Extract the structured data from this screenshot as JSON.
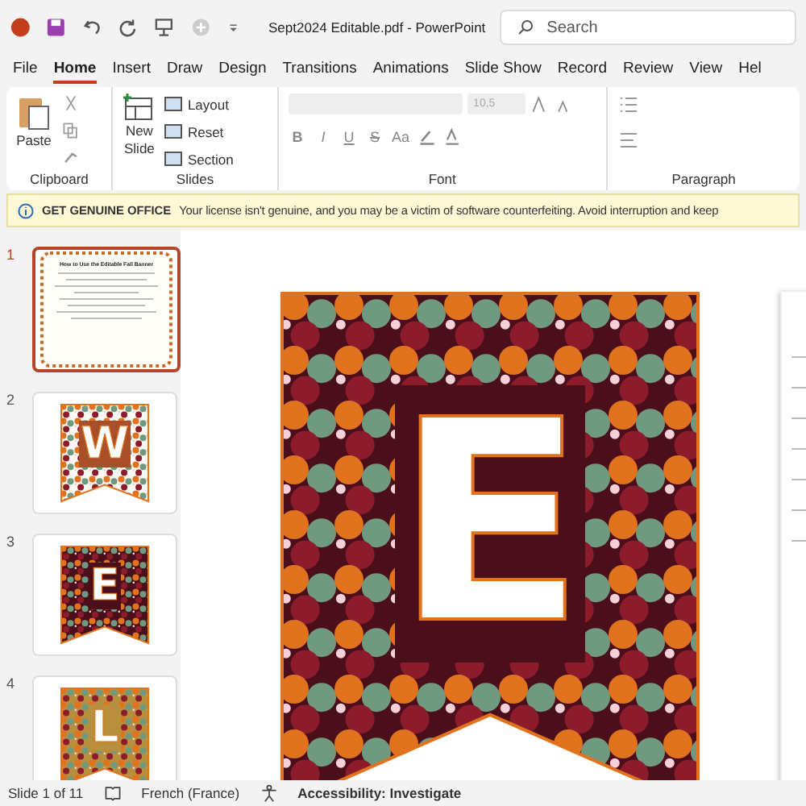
{
  "window": {
    "title": "Sept2024 Editable.pdf  -  PowerPoint",
    "search": {
      "placeholder": "Search"
    }
  },
  "tabs": [
    {
      "label": "File",
      "selected": false
    },
    {
      "label": "Home",
      "selected": true
    },
    {
      "label": "Insert",
      "selected": false
    },
    {
      "label": "Draw",
      "selected": false
    },
    {
      "label": "Design",
      "selected": false
    },
    {
      "label": "Transitions",
      "selected": false
    },
    {
      "label": "Animations",
      "selected": false
    },
    {
      "label": "Slide Show",
      "selected": false
    },
    {
      "label": "Record",
      "selected": false
    },
    {
      "label": "Review",
      "selected": false
    },
    {
      "label": "View",
      "selected": false
    },
    {
      "label": "Hel",
      "selected": false
    }
  ],
  "ribbon": {
    "clipboard": {
      "paste": "Paste",
      "label": "Clipboard"
    },
    "slides": {
      "new_slide": [
        "New",
        "Slide"
      ],
      "layout": "Layout",
      "reset": "Reset",
      "section": "Section",
      "label": "Slides"
    },
    "font": {
      "size": "10,5",
      "buttons": [
        "B",
        "I",
        "U",
        "S"
      ],
      "case": "Aa",
      "label": "Font"
    },
    "paragraph": {
      "label": "Paragraph"
    }
  },
  "message_bar": {
    "title": "GET GENUINE OFFICE",
    "text": "Your license isn't genuine, and you may be a victim of software counterfeiting. Avoid interruption and keep"
  },
  "thumbnails": [
    {
      "number": "1",
      "kind": "instructions",
      "title": "How to Use the Editable Fall Banner",
      "selected": true
    },
    {
      "number": "2",
      "kind": "banner",
      "letter": "W",
      "color": "#fbf7f2",
      "selected": false
    },
    {
      "number": "3",
      "kind": "banner",
      "letter": "E",
      "color": "#4a0f1a",
      "selected": false
    },
    {
      "number": "4",
      "kind": "banner",
      "letter": "L",
      "color": "#b88f3c",
      "selected": false
    }
  ],
  "slide": {
    "letter": "E",
    "color": "#4a0f1a"
  },
  "status_bar": {
    "slide": "Slide 1 of 11",
    "language": "French (France)",
    "accessibility": "Accessibility: Investigate"
  }
}
